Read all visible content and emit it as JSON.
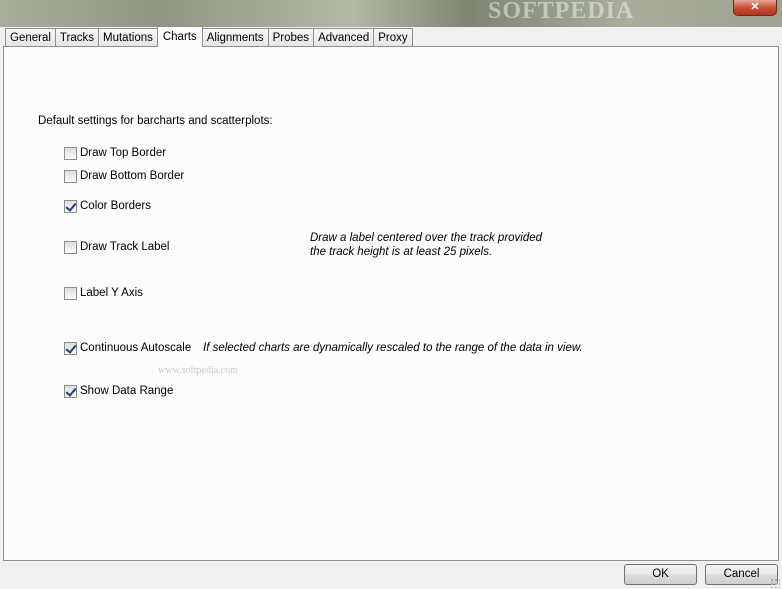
{
  "titlebar": {
    "watermark": "SOFTPEDIA",
    "close_icon": "close-icon"
  },
  "tabs": [
    {
      "label": "General",
      "active": false
    },
    {
      "label": "Tracks",
      "active": false
    },
    {
      "label": "Mutations",
      "active": false
    },
    {
      "label": "Charts",
      "active": true
    },
    {
      "label": "Alignments",
      "active": false
    },
    {
      "label": "Probes",
      "active": false
    },
    {
      "label": "Advanced",
      "active": false
    },
    {
      "label": "Proxy",
      "active": false
    }
  ],
  "charts": {
    "intro": "Default settings for barcharts and scatterplots:",
    "options": [
      {
        "label": "Draw Top Border",
        "checked": false
      },
      {
        "label": "Draw Bottom Border",
        "checked": false
      },
      {
        "label": "Color Borders",
        "checked": true
      },
      {
        "label": "Draw Track Label",
        "checked": false
      },
      {
        "label": "Label Y Axis",
        "checked": false
      },
      {
        "label": "Continuous Autoscale",
        "checked": true
      },
      {
        "label": "Show Data Range",
        "checked": true
      }
    ],
    "track_label_note_line1": "Draw a label centered over the track provided",
    "track_label_note_line2": "the track height is at least 25 pixels.",
    "autoscale_note": "If selected charts are dynamically rescaled to the range of the data in view.",
    "watermark": "www.softpedia.com"
  },
  "footer": {
    "ok_label": "OK",
    "cancel_label": "Cancel"
  }
}
